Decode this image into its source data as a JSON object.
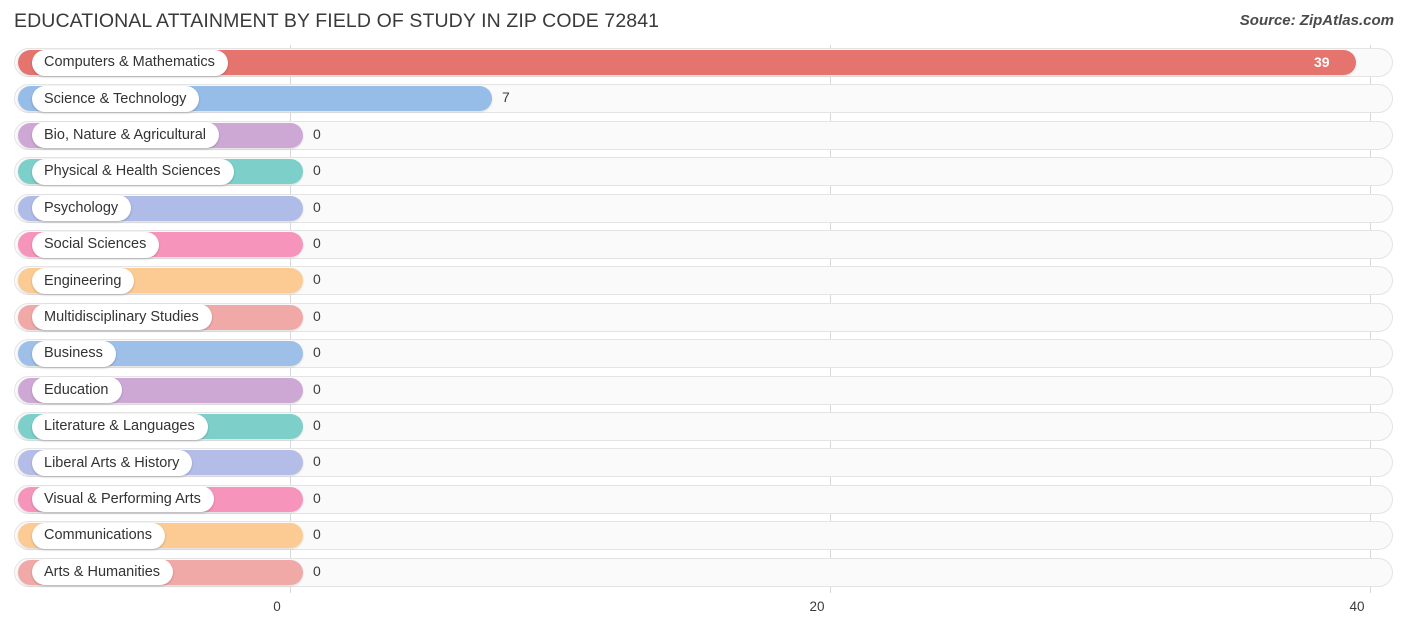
{
  "header": {
    "title": "EDUCATIONAL ATTAINMENT BY FIELD OF STUDY IN ZIP CODE 72841",
    "source": "Source: ZipAtlas.com"
  },
  "chart_data": {
    "type": "bar",
    "orientation": "horizontal",
    "title": "EDUCATIONAL ATTAINMENT BY FIELD OF STUDY IN ZIP CODE 72841",
    "xlabel": "",
    "ylabel": "",
    "xlim": [
      0,
      40
    ],
    "ticks": [
      0,
      20,
      40
    ],
    "tick_labels": [
      "0",
      "20",
      "40"
    ],
    "grid": true,
    "legend": "none",
    "categories": [
      "Computers & Mathematics",
      "Science & Technology",
      "Bio, Nature & Agricultural",
      "Physical & Health Sciences",
      "Psychology",
      "Social Sciences",
      "Engineering",
      "Multidisciplinary Studies",
      "Business",
      "Education",
      "Literature & Languages",
      "Liberal Arts & History",
      "Visual & Performing Arts",
      "Communications",
      "Arts & Humanities"
    ],
    "values": [
      39,
      7,
      0,
      0,
      0,
      0,
      0,
      0,
      0,
      0,
      0,
      0,
      0,
      0,
      0
    ],
    "value_labels": [
      "39",
      "7",
      "0",
      "0",
      "0",
      "0",
      "0",
      "0",
      "0",
      "0",
      "0",
      "0",
      "0",
      "0",
      "0"
    ],
    "colors": [
      "#e5736e",
      "#96bce8",
      "#cda8d5",
      "#7dcfc9",
      "#afbce8",
      "#f794bc",
      "#fbcb93",
      "#f0a9a6",
      "#9dbfe8",
      "#cda8d5",
      "#7dcfc9",
      "#b4bde8",
      "#f794bc",
      "#fbcb93",
      "#f0a9a6"
    ]
  },
  "axis": {
    "tick_labels": [
      "0",
      "20",
      "40"
    ]
  }
}
